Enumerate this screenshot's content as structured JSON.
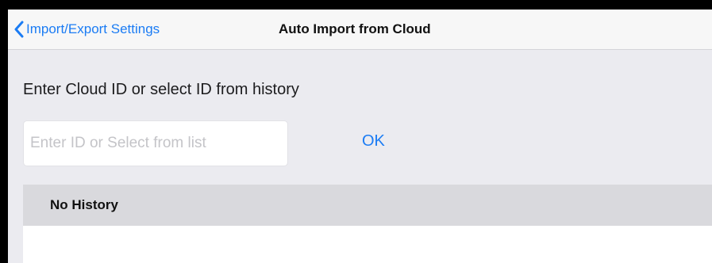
{
  "nav": {
    "back_label": "Import/Export Settings",
    "title": "Auto Import from Cloud"
  },
  "form": {
    "instruction": "Enter Cloud ID or select ID from history",
    "id_placeholder": "Enter ID or Select from list",
    "id_value": "",
    "ok_label": "OK"
  },
  "history": {
    "header": "No History",
    "items": []
  },
  "colors": {
    "accent": "#1b7cf4",
    "background": "#ebebf0",
    "header_background": "#d9d9dd"
  },
  "icons": {
    "back": "chevron-left-icon"
  }
}
